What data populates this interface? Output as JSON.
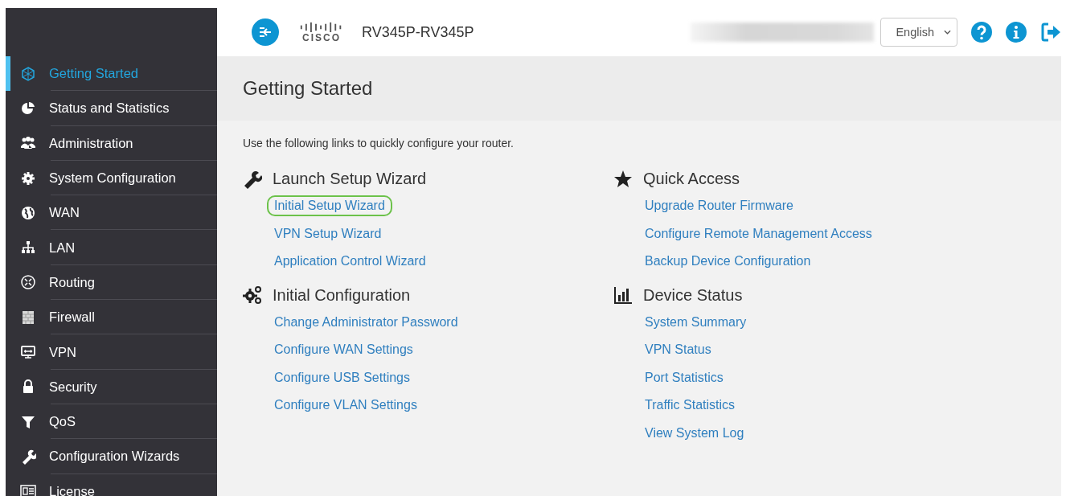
{
  "header": {
    "logo_text": "CISCO",
    "device_name": "RV345P-RV345P",
    "language": "English"
  },
  "sidebar": {
    "items": [
      {
        "label": "Getting Started",
        "selected": true
      },
      {
        "label": "Status and Statistics",
        "selected": false
      },
      {
        "label": "Administration",
        "selected": false
      },
      {
        "label": "System Configuration",
        "selected": false
      },
      {
        "label": "WAN",
        "selected": false
      },
      {
        "label": "LAN",
        "selected": false
      },
      {
        "label": "Routing",
        "selected": false
      },
      {
        "label": "Firewall",
        "selected": false
      },
      {
        "label": "VPN",
        "selected": false
      },
      {
        "label": "Security",
        "selected": false
      },
      {
        "label": "QoS",
        "selected": false
      },
      {
        "label": "Configuration Wizards",
        "selected": false
      },
      {
        "label": "License",
        "selected": false
      }
    ]
  },
  "page": {
    "title": "Getting Started",
    "intro": "Use the following links to quickly configure your router.",
    "sections": [
      {
        "title": "Launch Setup Wizard",
        "links": [
          {
            "label": "Initial Setup Wizard",
            "highlighted": true
          },
          {
            "label": "VPN Setup Wizard",
            "highlighted": false
          },
          {
            "label": "Application Control Wizard",
            "highlighted": false
          }
        ]
      },
      {
        "title": "Quick Access",
        "links": [
          {
            "label": "Upgrade Router Firmware",
            "highlighted": false
          },
          {
            "label": "Configure Remote Management Access",
            "highlighted": false
          },
          {
            "label": "Backup Device Configuration",
            "highlighted": false
          }
        ]
      },
      {
        "title": "Initial Configuration",
        "links": [
          {
            "label": "Change Administrator Password",
            "highlighted": false
          },
          {
            "label": "Configure WAN Settings",
            "highlighted": false
          },
          {
            "label": "Configure USB Settings",
            "highlighted": false
          },
          {
            "label": "Configure VLAN Settings",
            "highlighted": false
          }
        ]
      },
      {
        "title": "Device Status",
        "links": [
          {
            "label": "System Summary",
            "highlighted": false
          },
          {
            "label": "VPN Status",
            "highlighted": false
          },
          {
            "label": "Port Statistics",
            "highlighted": false
          },
          {
            "label": "Traffic Statistics",
            "highlighted": false
          },
          {
            "label": "View System Log",
            "highlighted": false
          }
        ]
      }
    ]
  }
}
